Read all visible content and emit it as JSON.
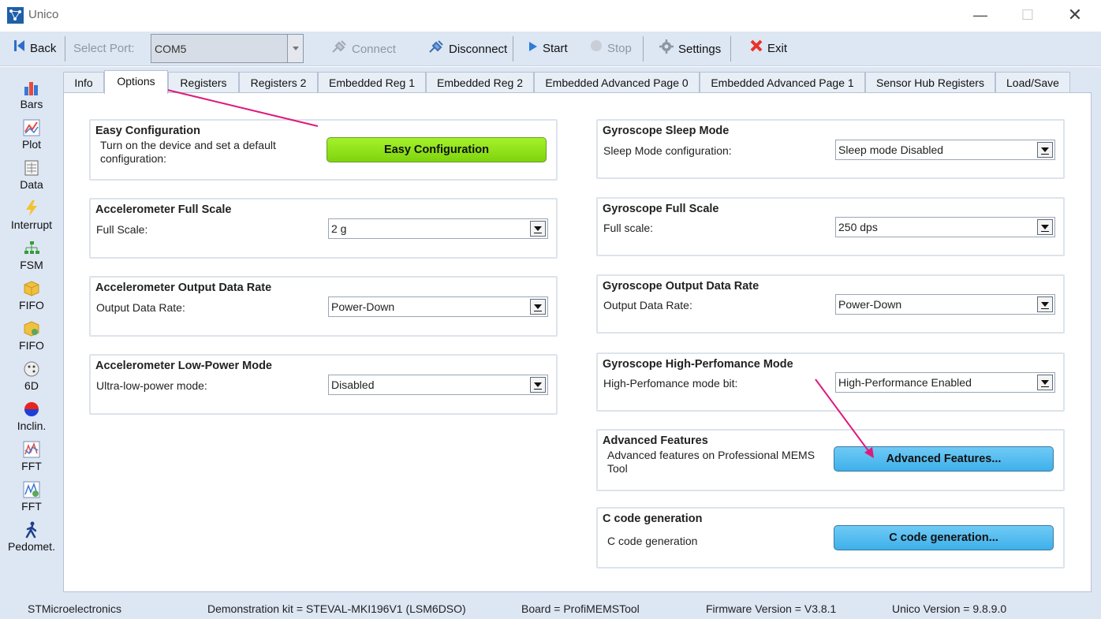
{
  "window": {
    "title": "Unico",
    "minimize": "—",
    "maximize": "☐",
    "close": "✕"
  },
  "toolbar": {
    "back": "Back",
    "select_port_label": "Select Port:",
    "port_value": "COM5",
    "connect": "Connect",
    "disconnect": "Disconnect",
    "start": "Start",
    "stop": "Stop",
    "settings": "Settings",
    "exit": "Exit"
  },
  "sidebar": {
    "items": [
      {
        "label": "Bars",
        "icon": "bar-chart-icon"
      },
      {
        "label": "Plot",
        "icon": "line-plot-icon"
      },
      {
        "label": "Data",
        "icon": "data-table-icon"
      },
      {
        "label": "Interrupt",
        "icon": "lightning-icon"
      },
      {
        "label": "FSM",
        "icon": "state-machine-icon"
      },
      {
        "label": "FIFO",
        "icon": "box-icon"
      },
      {
        "label": "FIFO",
        "icon": "box-gear-icon"
      },
      {
        "label": "6D",
        "icon": "dice-icon"
      },
      {
        "label": "Inclin.",
        "icon": "inclinometer-icon"
      },
      {
        "label": "FFT",
        "icon": "fft-icon"
      },
      {
        "label": "FFT",
        "icon": "fft-settings-icon"
      },
      {
        "label": "Pedomet.",
        "icon": "walking-person-icon"
      }
    ]
  },
  "tabs": [
    {
      "label": "Info"
    },
    {
      "label": "Options",
      "active": true
    },
    {
      "label": "Registers"
    },
    {
      "label": "Registers 2"
    },
    {
      "label": "Embedded Reg 1"
    },
    {
      "label": "Embedded Reg 2"
    },
    {
      "label": "Embedded Advanced Page 0"
    },
    {
      "label": "Embedded Advanced Page 1"
    },
    {
      "label": "Sensor Hub Registers"
    },
    {
      "label": "Load/Save"
    }
  ],
  "options": {
    "easy_config": {
      "title": "Easy Configuration",
      "desc_line1": "Turn on the device and set a default",
      "desc_line2": "configuration:",
      "button": "Easy Configuration"
    },
    "acc_full_scale": {
      "title": "Accelerometer Full Scale",
      "label": "Full Scale:",
      "value": "2 g"
    },
    "acc_odr": {
      "title": "Accelerometer Output Data Rate",
      "label": "Output Data Rate:",
      "value": "Power-Down"
    },
    "acc_low_power": {
      "title": "Accelerometer Low-Power Mode",
      "label": "Ultra-low-power mode:",
      "value": "Disabled"
    },
    "gyro_sleep": {
      "title": "Gyroscope Sleep Mode",
      "label": "Sleep Mode configuration:",
      "value": "Sleep mode Disabled"
    },
    "gyro_full_scale": {
      "title": "Gyroscope Full Scale",
      "label": "Full scale:",
      "value": "250 dps"
    },
    "gyro_odr": {
      "title": "Gyroscope Output Data Rate",
      "label": "Output Data Rate:",
      "value": "Power-Down"
    },
    "gyro_hp": {
      "title": "Gyroscope High-Perfomance Mode",
      "label": "High-Perfomance mode bit:",
      "value": "High-Performance Enabled"
    },
    "advanced": {
      "title": "Advanced Features",
      "desc_line1": "Advanced features on Professional MEMS",
      "desc_line2": "Tool",
      "button": "Advanced Features..."
    },
    "ccode": {
      "title": "C code generation",
      "label": "C code generation",
      "button": "C code generation..."
    }
  },
  "status": {
    "vendor": "STMicroelectronics",
    "kit": "Demonstration kit = STEVAL-MKI196V1 (LSM6DSO)",
    "board": "Board = ProfiMEMSTool",
    "firmware": "Firmware Version = V3.8.1",
    "unico": "Unico Version = 9.8.9.0"
  },
  "colors": {
    "annotation_arrow": "#e0197d",
    "easy_button": "#8fe21a",
    "advanced_button": "#4db9ee"
  }
}
